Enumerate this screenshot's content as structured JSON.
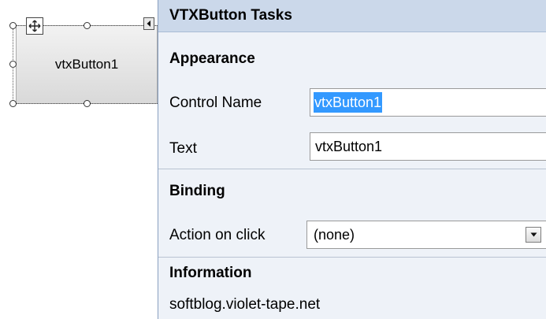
{
  "designer": {
    "button_text": "vtxButton1"
  },
  "tasks_panel": {
    "title": "VTXButton Tasks",
    "appearance": {
      "heading": "Appearance",
      "control_name_label": "Control Name",
      "control_name_value": "vtxButton1",
      "text_label": "Text",
      "text_value": "vtxButton1"
    },
    "binding": {
      "heading": "Binding",
      "action_label": "Action on click",
      "action_value": "(none)"
    },
    "information": {
      "heading": "Information",
      "text": "softblog.violet-tape.net"
    }
  },
  "icons": {
    "move": "move-arrows-icon",
    "smart_tag": "smart-tag-arrow-icon",
    "dropdown": "chevron-down-icon"
  },
  "colors": {
    "panel_background": "#eef2f8",
    "panel_header": "#cbd8ea",
    "selection": "#3399ff"
  }
}
